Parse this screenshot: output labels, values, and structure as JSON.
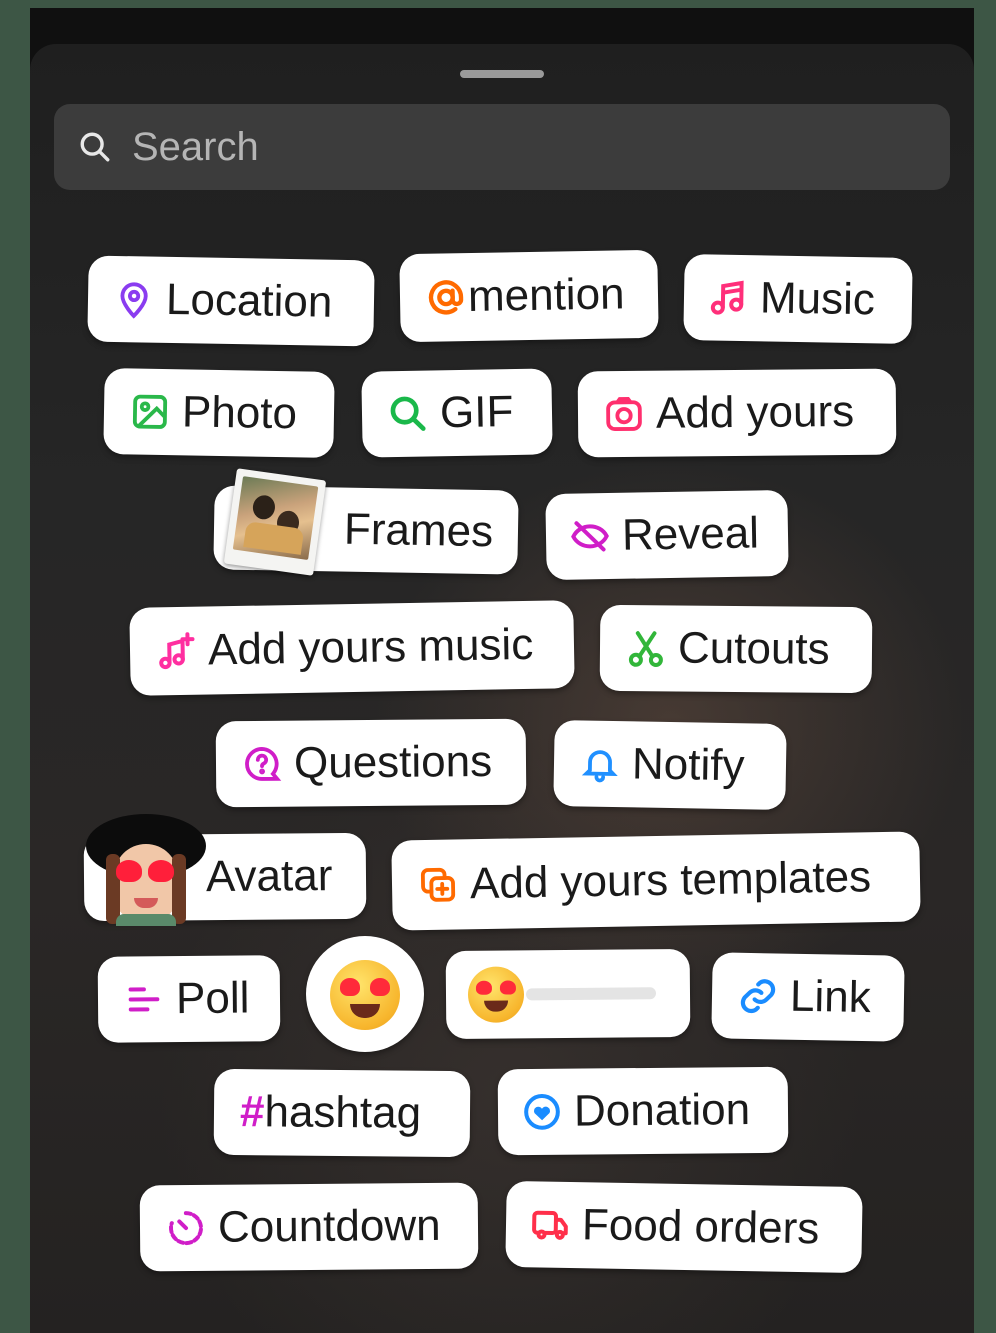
{
  "search": {
    "placeholder": "Search"
  },
  "stickers": {
    "location": "Location",
    "mention": "mention",
    "music": "Music",
    "photo": "Photo",
    "gif": "GIF",
    "add_yours": "Add yours",
    "frames": "Frames",
    "reveal": "Reveal",
    "add_yours_music": "Add yours music",
    "cutouts": "Cutouts",
    "questions": "Questions",
    "notify": "Notify",
    "avatar": "Avatar",
    "add_yours_templates": "Add yours templates",
    "poll": "Poll",
    "link": "Link",
    "hashtag": "hashtag",
    "donation": "Donation",
    "countdown": "Countdown",
    "food_orders": "Food orders"
  },
  "icons": {
    "location": "location-pin-icon",
    "mention": "at-sign-icon",
    "music": "music-note-icon",
    "photo": "image-icon",
    "gif": "search-icon",
    "add_yours": "camera-icon",
    "reveal": "eye-off-icon",
    "add_yours_music": "music-plus-icon",
    "cutouts": "scissors-icon",
    "questions": "question-bubble-icon",
    "notify": "bell-icon",
    "add_yours_templates": "copy-plus-icon",
    "poll": "poll-bars-icon",
    "link": "link-icon",
    "hashtag": "hashtag-icon",
    "donation": "heart-circle-icon",
    "countdown": "timer-icon",
    "food_orders": "delivery-icon"
  },
  "colors": {
    "location": "#8a3cf0",
    "mention": "#ff6a00",
    "music": "#ff2f7a",
    "photo": "#2ab84a",
    "gif": "#1ab84a",
    "add_yours": "#ff2f6e",
    "reveal": "#d01ec8",
    "add_yours_music": "#ff2fa0",
    "cutouts": "#32b63a",
    "questions": "#d01ec8",
    "notify": "#2090ff",
    "add_yours_templates": "#ff6a00",
    "poll": "#d01ec8",
    "link": "#1a8cff",
    "hashtag": "#d01ec8",
    "donation": "#1a8cff",
    "countdown": "#d01ec8",
    "food_orders": "#ff2f4a"
  },
  "emoji_slider": {
    "value": 0
  }
}
